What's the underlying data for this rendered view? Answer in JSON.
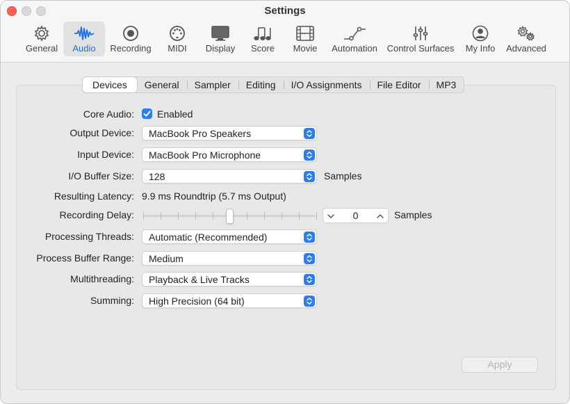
{
  "window": {
    "title": "Settings"
  },
  "toolbar": {
    "items": [
      {
        "label": "General",
        "icon": "gear-icon"
      },
      {
        "label": "Audio",
        "icon": "waveform-icon",
        "selected": true
      },
      {
        "label": "Recording",
        "icon": "record-icon"
      },
      {
        "label": "MIDI",
        "icon": "midi-port-icon"
      },
      {
        "label": "Display",
        "icon": "display-icon"
      },
      {
        "label": "Score",
        "icon": "music-notes-icon"
      },
      {
        "label": "Movie",
        "icon": "film-icon"
      },
      {
        "label": "Automation",
        "icon": "automation-curve-icon"
      },
      {
        "label": "Control Surfaces",
        "icon": "faders-icon"
      },
      {
        "label": "My Info",
        "icon": "person-icon"
      },
      {
        "label": "Advanced",
        "icon": "gears-icon"
      }
    ]
  },
  "tabs": [
    {
      "label": "Devices",
      "selected": true
    },
    {
      "label": "General"
    },
    {
      "label": "Sampler"
    },
    {
      "label": "Editing"
    },
    {
      "label": "I/O Assignments"
    },
    {
      "label": "File Editor"
    },
    {
      "label": "MP3"
    }
  ],
  "devices": {
    "core_audio": {
      "label": "Core Audio:",
      "checkbox_label": "Enabled",
      "checked": true
    },
    "output_device": {
      "label": "Output Device:",
      "value": "MacBook Pro Speakers"
    },
    "input_device": {
      "label": "Input Device:",
      "value": "MacBook Pro Microphone"
    },
    "io_buffer_size": {
      "label": "I/O Buffer Size:",
      "value": "128",
      "unit": "Samples"
    },
    "resulting_latency": {
      "label": "Resulting Latency:",
      "value": "9.9 ms Roundtrip (5.7 ms Output)"
    },
    "recording_delay": {
      "label": "Recording Delay:",
      "value": "0",
      "unit": "Samples"
    },
    "processing_threads": {
      "label": "Processing Threads:",
      "value": "Automatic (Recommended)"
    },
    "process_buffer_range": {
      "label": "Process Buffer Range:",
      "value": "Medium"
    },
    "multithreading": {
      "label": "Multithreading:",
      "value": "Playback & Live Tracks"
    },
    "summing": {
      "label": "Summing:",
      "value": "High Precision (64 bit)"
    }
  },
  "apply_button": {
    "label": "Apply",
    "enabled": false
  },
  "colors": {
    "accent": "#2c7ef0",
    "close": "#fe5f57",
    "selected_toolbar_text": "#1a6fe0"
  }
}
